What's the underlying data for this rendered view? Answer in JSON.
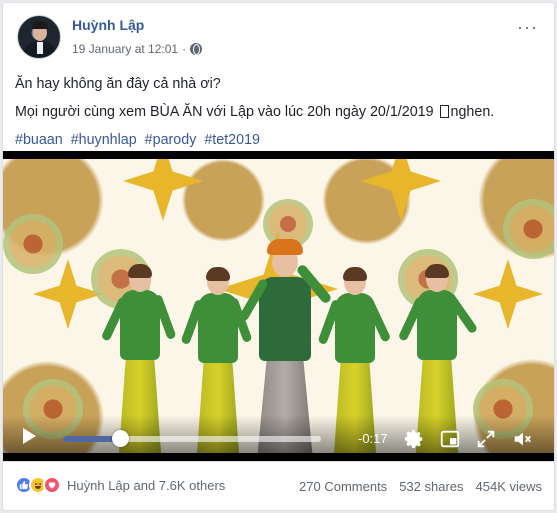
{
  "post": {
    "author": "Huỳnh Lập",
    "date": "19 January at 12:01",
    "privacy_icon": "globe-icon",
    "more_label": "···",
    "line1": "Ăn hay không ăn đây cả nhà ơi?",
    "line2_before": "Mọi người cùng xem BÙA ĂN với Lập vào lúc 20h ngày 20/1/2019",
    "line2_after": "nghen.",
    "hashtags": [
      "#buaan",
      "#huynhlap",
      "#parody",
      "#tet2019"
    ]
  },
  "video": {
    "time_remaining": "-0:17",
    "progress": 0.22,
    "controls": [
      "play-icon",
      "gear-icon",
      "theater-mode-icon",
      "fullscreen-icon",
      "mute-icon"
    ]
  },
  "footer": {
    "reactions": [
      "like-icon",
      "haha-icon",
      "love-icon"
    ],
    "reaction_text": "Huỳnh Lập and 7.6K others",
    "comments": "270 Comments",
    "shares": "532 shares",
    "views": "454K views"
  },
  "colors": {
    "link": "#385898",
    "accent": "#4e69a2",
    "muted": "#606770"
  }
}
